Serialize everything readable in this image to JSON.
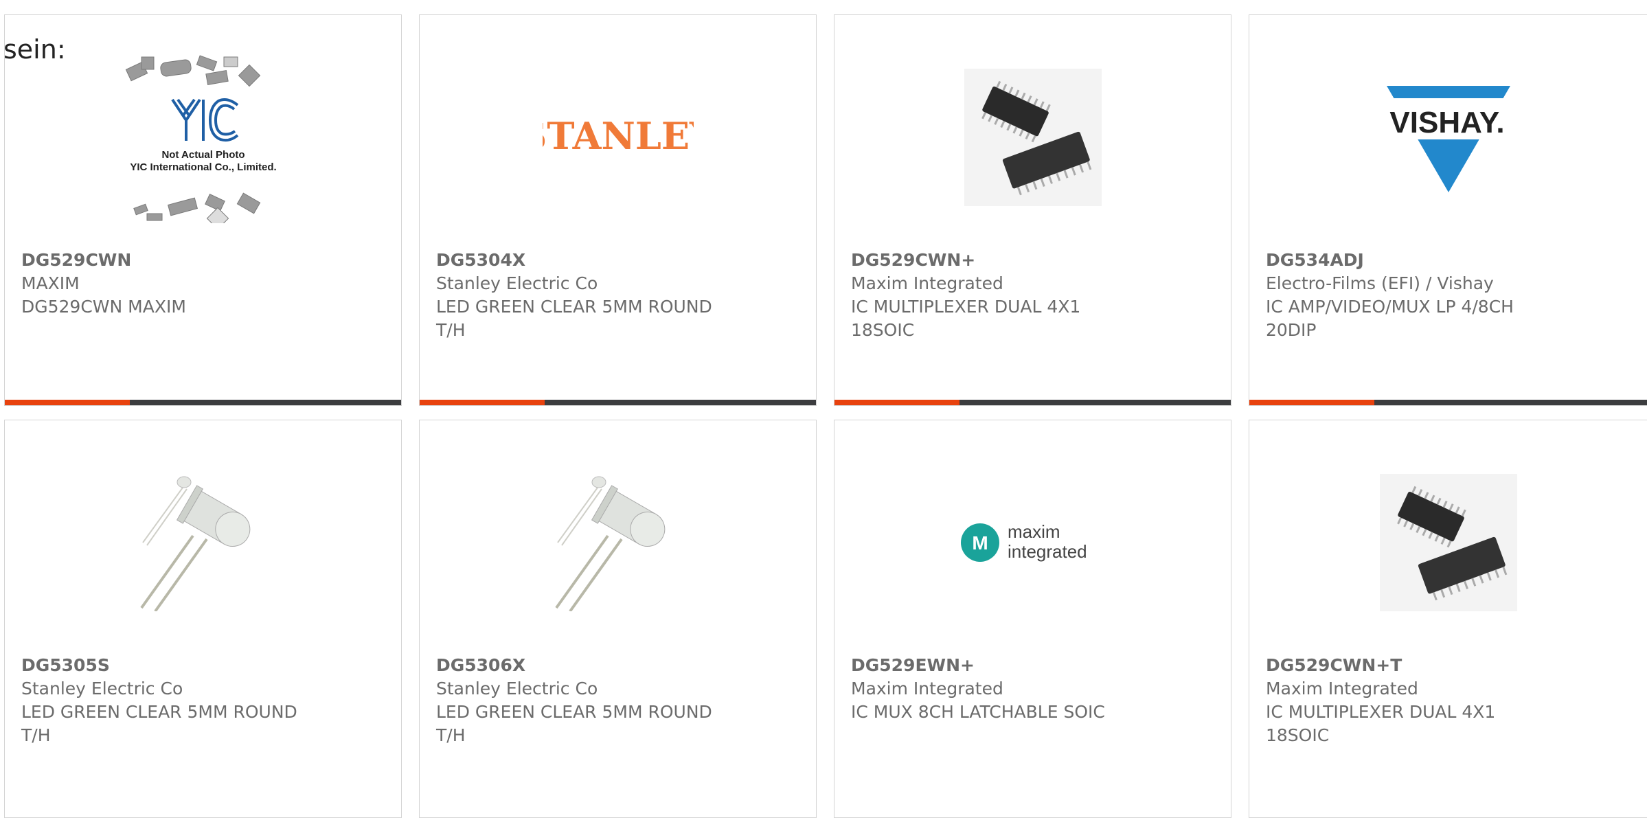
{
  "intro_text": "sein:",
  "colors": {
    "accent": "#e8420e",
    "bar": "#3c3d3f",
    "border": "#d4d4d4",
    "text": "#6b6b6b"
  },
  "products": [
    {
      "part": "DG529CWN",
      "maker": "MAXIM",
      "desc": "DG529CWN MAXIM",
      "image": "yic-placeholder",
      "image_text": [
        "Not Actual Photo",
        "YIC International Co., Limited."
      ]
    },
    {
      "part": "DG5304X",
      "maker": "Stanley Electric Co",
      "desc": "LED GREEN CLEAR 5MM ROUND T/H",
      "image": "stanley-logo",
      "image_text": [
        "STANLEY"
      ]
    },
    {
      "part": "DG529CWN+",
      "maker": "Maxim Integrated",
      "desc": "IC MULTIPLEXER DUAL 4X1 18SOIC",
      "image": "soic-chips"
    },
    {
      "part": "DG534ADJ",
      "maker": "Electro-Films (EFI) / Vishay",
      "desc": "IC AMP/VIDEO/MUX LP 4/8CH 20DIP",
      "image": "vishay-logo",
      "image_text": [
        "VISHAY."
      ]
    },
    {
      "part": "DG5305S",
      "maker": "Stanley Electric Co",
      "desc": "LED GREEN CLEAR 5MM ROUND T/H",
      "image": "led-photo"
    },
    {
      "part": "DG5306X",
      "maker": "Stanley Electric Co",
      "desc": "LED GREEN CLEAR 5MM ROUND T/H",
      "image": "led-photo"
    },
    {
      "part": "DG529EWN+",
      "maker": "Maxim Integrated",
      "desc": "IC MUX 8CH LATCHABLE SOIC",
      "image": "maxim-logo",
      "image_text": [
        "maxim",
        "integrated"
      ]
    },
    {
      "part": "DG529CWN+T",
      "maker": "Maxim Integrated",
      "desc": "IC MULTIPLEXER DUAL 4X1 18SOIC",
      "image": "soic-chips"
    }
  ]
}
